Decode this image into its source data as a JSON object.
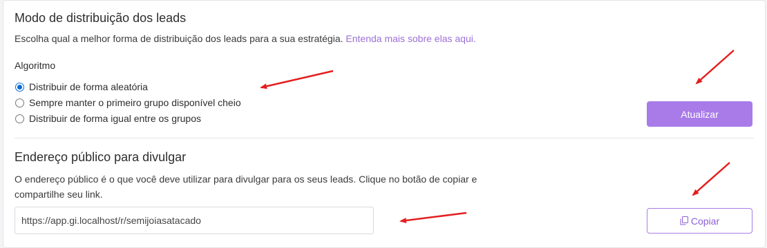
{
  "distribution": {
    "title": "Modo de distribuição dos leads",
    "description": "Escolha qual a melhor forma de distribuição dos leads para a sua estratégia.",
    "learn_more_link": "Entenda mais sobre elas aqui.",
    "algorithm_label": "Algoritmo",
    "options": [
      {
        "label": "Distribuir de forma aleatória",
        "selected": true
      },
      {
        "label": "Sempre manter o primeiro grupo disponível cheio",
        "selected": false
      },
      {
        "label": "Distribuir de forma igual entre os grupos",
        "selected": false
      }
    ],
    "update_button": "Atualizar"
  },
  "public_address": {
    "title": "Endereço público para divulgar",
    "description_line1": "O endereço público é o que você deve utilizar para divulgar para os seus leads. Clique no botão de copiar e",
    "description_line2": "compartilhe seu link.",
    "url_value": "https://app.gi.localhost/r/semijoiasatacado",
    "copy_button": "Copiar"
  },
  "colors": {
    "accent": "#a87be8",
    "link": "#9b6fd6",
    "annotation_arrow": "#e41e1e",
    "radio_selected": "#0b6cd8"
  }
}
